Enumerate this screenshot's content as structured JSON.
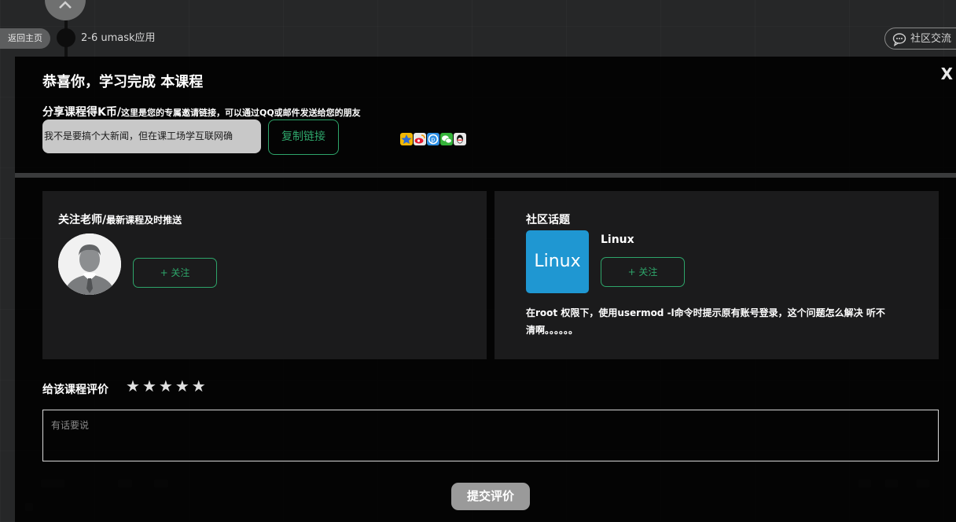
{
  "background": {
    "back_home": "返回主页",
    "chapter_title": "2-6 umask应用",
    "community_button": "社区交流"
  },
  "modal": {
    "title": "恭喜你，学习完成 本课程",
    "close_label": "X",
    "share": {
      "title": "分享课程得K币/",
      "description": "这里是您的专属邀请链接，可以通过QQ或邮件发送给您的朋友",
      "link_text": "我不是要搞个大新闻，但在课工场学互联网确",
      "copy_button": "复制链接",
      "icons": [
        "qzone-icon",
        "weibo-icon",
        "pengyou-icon",
        "wechat-icon",
        "qq-icon"
      ]
    },
    "teacher": {
      "title": "关注老师/",
      "subtitle": "最新课程及时推送",
      "follow_button": "+ 关注"
    },
    "community": {
      "title": "社区话题",
      "topic_logo_text": "Linux",
      "topic_name": "Linux",
      "follow_button": "+ 关注",
      "question": "在root 权限下，使用usermod -l命令时提示原有账号登录，这个问题怎么解决 听不清啊。。。。。。"
    },
    "rating": {
      "label": "给该课程评价",
      "stars": 5,
      "star_glyph": "★",
      "comment_placeholder": "有话要说",
      "submit_button": "提交评价"
    }
  },
  "colors": {
    "accent_green": "#2ea56a",
    "linux_blue": "#1f97d2",
    "overlay": "#020202"
  }
}
